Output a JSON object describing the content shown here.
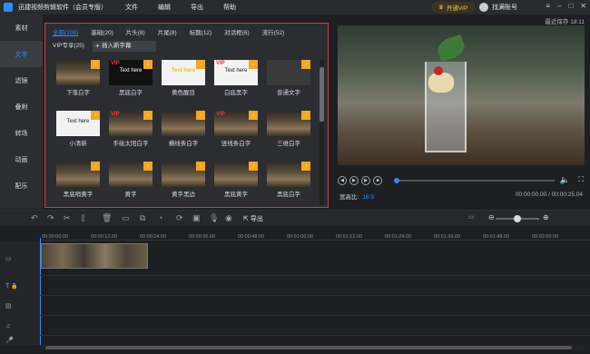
{
  "app": {
    "title": "迅捷视频剪辑软件（会员专版）"
  },
  "menu": [
    "文件",
    "编辑",
    "导出",
    "帮助"
  ],
  "vip_button": "开通VIP",
  "account": "找满账号",
  "last_saved": "最近保存 18:11",
  "sidebar": [
    {
      "label": "素材",
      "active": false
    },
    {
      "label": "文字",
      "active": true
    },
    {
      "label": "滤镜",
      "active": false
    },
    {
      "label": "叠附",
      "active": false
    },
    {
      "label": "转场",
      "active": false
    },
    {
      "label": "动画",
      "active": false
    },
    {
      "label": "配乐",
      "active": false
    }
  ],
  "text_panel": {
    "tabs": [
      {
        "label": "全部(106)",
        "active": true
      },
      {
        "label": "基础(20)"
      },
      {
        "label": "片头(8)"
      },
      {
        "label": "片尾(8)"
      },
      {
        "label": "标题(12)"
      },
      {
        "label": "对话框(6)"
      },
      {
        "label": "流行(52)"
      },
      {
        "label": "VIP专享(25)"
      }
    ],
    "insert_button": "插入新字幕",
    "items": [
      {
        "caption": "下落白字",
        "style": "photo",
        "thumb_text": ""
      },
      {
        "caption": "黑底白字",
        "style": "black",
        "thumb_text": "Text here",
        "vip": true
      },
      {
        "caption": "黄色醒目",
        "style": "white",
        "thumb_text": "Text here",
        "text_style": "yellow"
      },
      {
        "caption": "白底黑字",
        "style": "white",
        "thumb_text": "Text here",
        "text_style": "dark",
        "vip": true
      },
      {
        "caption": "普通文字",
        "style": "dark",
        "thumb_text": ""
      },
      {
        "caption": "小清新",
        "style": "white",
        "thumb_text": "Text here",
        "text_style": "dark"
      },
      {
        "caption": "手绘太阳白字",
        "style": "photo",
        "thumb_text": "",
        "vip": true
      },
      {
        "caption": "横线条白字",
        "style": "photo",
        "thumb_text": ""
      },
      {
        "caption": "竖线条白字",
        "style": "photo",
        "thumb_text": "",
        "vip": true
      },
      {
        "caption": "三维白字",
        "style": "photo",
        "thumb_text": ""
      },
      {
        "caption": "黑底哨黄字",
        "style": "photo",
        "thumb_text": ""
      },
      {
        "caption": "黄字",
        "style": "photo",
        "thumb_text": ""
      },
      {
        "caption": "黄字黑边",
        "style": "photo",
        "thumb_text": ""
      },
      {
        "caption": "黑底黄字",
        "style": "photo",
        "thumb_text": ""
      },
      {
        "caption": "黑底白字",
        "style": "photo",
        "thumb_text": ""
      }
    ]
  },
  "preview": {
    "aspect_label": "宽高比:",
    "aspect_value": "16:9",
    "timecode": "00:00:00.00 / 00:00:25.04",
    "progress": 0.0
  },
  "toolbar": {
    "export_label": "导出"
  },
  "ruler": [
    "00:00:00.00",
    "00:00:12.00",
    "00:00:24.00",
    "00:00:36.00",
    "00:00:48.00",
    "00:01:00.00",
    "00:01:12.00",
    "00:01:24.00",
    "00:01:36.00",
    "00:01:48.00",
    "00:02:00.00"
  ],
  "tracks": [
    "video",
    "text",
    "overlay",
    "music",
    "voice"
  ]
}
